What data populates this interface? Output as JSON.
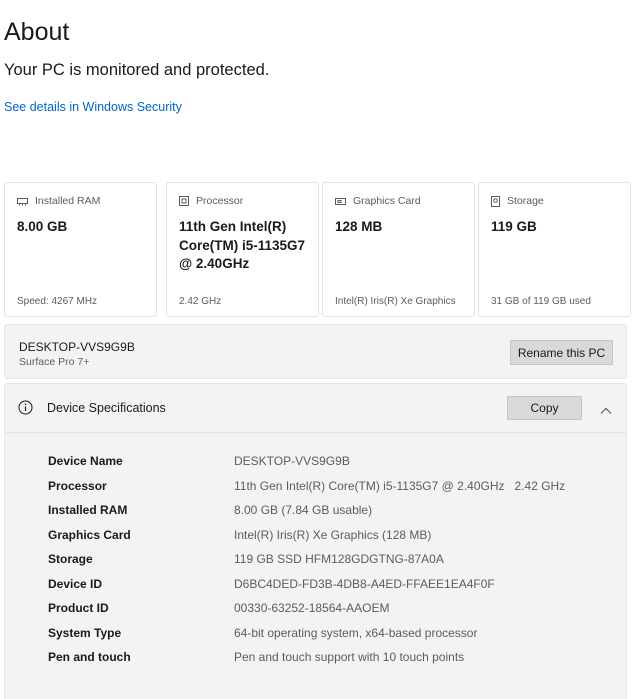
{
  "header": {
    "title": "About",
    "status": "Your PC is monitored and protected.",
    "security_link": "See details in Windows Security"
  },
  "cards": [
    {
      "label": "Installed RAM",
      "value": "8.00 GB",
      "detail": "Speed: 4267 MHz",
      "icon": "ram-icon"
    },
    {
      "label": "Processor",
      "value": "11th Gen Intel(R) Core(TM) i5-1135G7 @ 2.40GHz",
      "detail": "2.42 GHz",
      "icon": "processor-icon"
    },
    {
      "label": "Graphics Card",
      "value": "128 MB",
      "detail": "Intel(R) Iris(R) Xe Graphics",
      "icon": "graphics-card-icon"
    },
    {
      "label": "Storage",
      "value": "119 GB",
      "detail": "31 GB of 119 GB used",
      "icon": "storage-icon"
    }
  ],
  "device": {
    "name": "DESKTOP-VVS9G9B",
    "model": "Surface Pro 7+",
    "rename_label": "Rename this PC"
  },
  "specs": {
    "title": "Device Specifications",
    "copy_label": "Copy",
    "rows": [
      {
        "label": "Device Name",
        "value": "DESKTOP-VVS9G9B"
      },
      {
        "label": "Processor",
        "value": "11th Gen Intel(R) Core(TM) i5-1135G7 @ 2.40GHz   2.42 GHz"
      },
      {
        "label": "Installed RAM",
        "value": "8.00 GB (7.84 GB usable)"
      },
      {
        "label": "Graphics Card",
        "value": "Intel(R) Iris(R) Xe Graphics (128 MB)"
      },
      {
        "label": "Storage",
        "value": "119 GB SSD HFM128GDGTNG-87A0A"
      },
      {
        "label": "Device ID",
        "value": "D6BC4DED-FD3B-4DB8-A4ED-FFAEE1EA4F0F"
      },
      {
        "label": "Product ID",
        "value": "00330-63252-18564-AAOEM"
      },
      {
        "label": "System Type",
        "value": "64-bit operating system, x64-based processor"
      },
      {
        "label": "Pen and touch",
        "value": "Pen and touch support with 10 touch points"
      }
    ]
  },
  "colors": {
    "accent_link": "#0067c0",
    "panel_bg": "#f3f3f3",
    "button_bg": "#d9d9d9"
  }
}
